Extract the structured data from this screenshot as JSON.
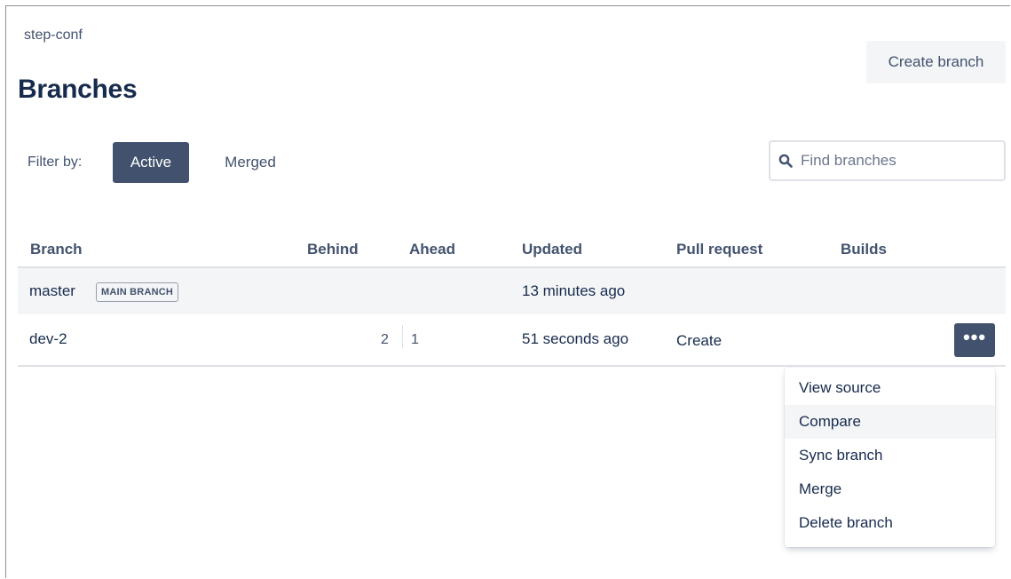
{
  "breadcrumb": "step-conf",
  "page_title": "Branches",
  "create_branch_label": "Create branch",
  "filter": {
    "label": "Filter by:",
    "options": [
      "Active",
      "Merged"
    ],
    "selected": "Active"
  },
  "search": {
    "placeholder": "Find branches",
    "value": ""
  },
  "table": {
    "columns": [
      "Branch",
      "Behind",
      "Ahead",
      "Updated",
      "Pull request",
      "Builds"
    ],
    "rows": [
      {
        "branch": "master",
        "badge": "MAIN BRANCH",
        "behind": "",
        "ahead": "",
        "updated": "13 minutes ago",
        "pull_request": "",
        "builds": ""
      },
      {
        "branch": "dev-2",
        "badge": "",
        "behind": "2",
        "ahead": "1",
        "updated": "51 seconds ago",
        "pull_request": "Create",
        "builds": ""
      }
    ]
  },
  "more_actions_icon": "more-horizontal-icon",
  "row_menu": {
    "items": [
      "View source",
      "Compare",
      "Sync branch",
      "Merge",
      "Delete branch"
    ],
    "highlighted": "Compare"
  },
  "colors": {
    "accent": "#42526e",
    "text": "#172b4d",
    "subtle_bg": "#f4f5f7",
    "border": "#dfe1e6"
  }
}
